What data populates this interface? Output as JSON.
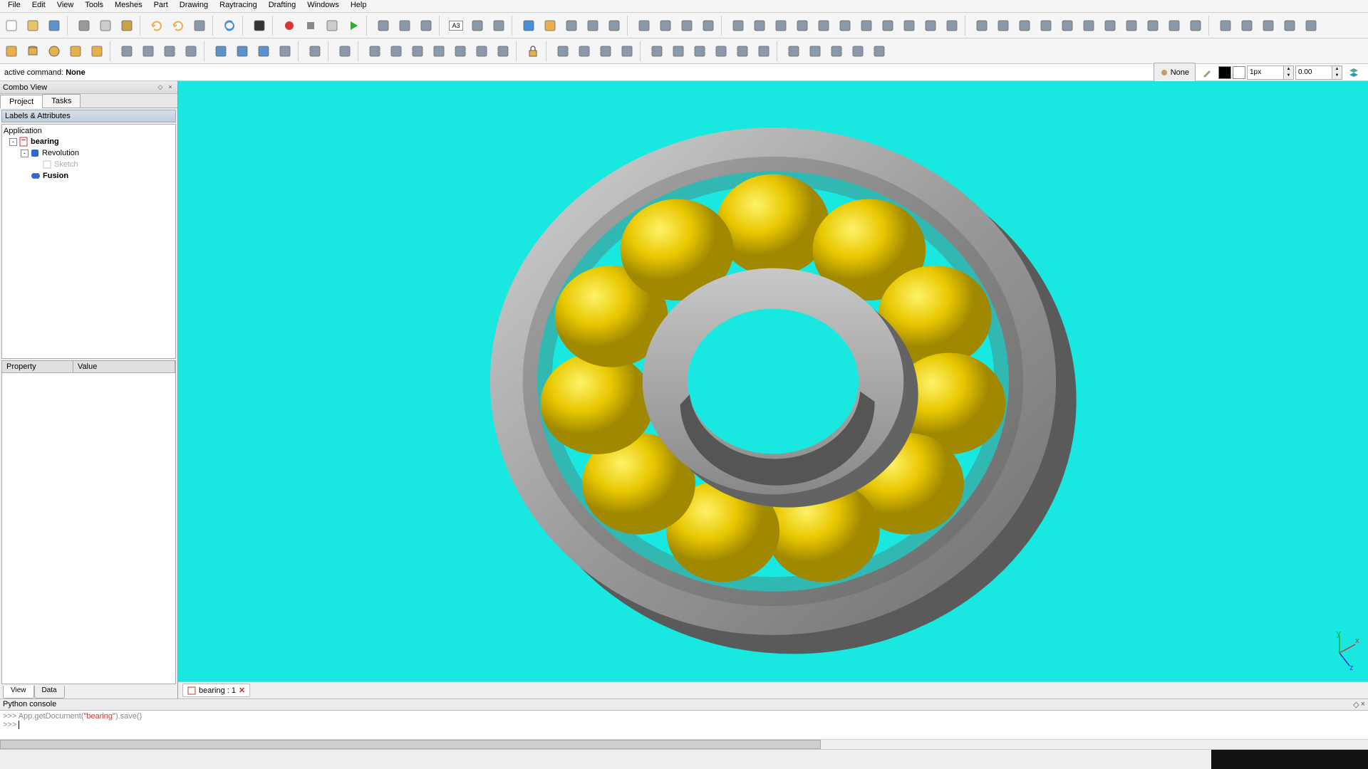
{
  "menu": [
    "File",
    "Edit",
    "View",
    "Tools",
    "Meshes",
    "Part",
    "Drawing",
    "Raytracing",
    "Drafting",
    "Windows",
    "Help"
  ],
  "commandbar": {
    "label": "active command:",
    "value": "None",
    "none_btn": "None",
    "px_field": "1px",
    "num_field": "0.00"
  },
  "combo": {
    "title": "Combo View",
    "tabs": [
      "Project",
      "Tasks"
    ],
    "active_tab": 0,
    "section": "Labels & Attributes",
    "tree": {
      "root": "Application",
      "items": [
        {
          "level": 0,
          "exp": "-",
          "icon": "doc",
          "label": "bearing",
          "bold": true
        },
        {
          "level": 1,
          "exp": "-",
          "icon": "rev",
          "label": "Revolution",
          "bold": false
        },
        {
          "level": 2,
          "exp": "",
          "icon": "sketch",
          "label": "Sketch",
          "bold": false,
          "dim": true
        },
        {
          "level": 1,
          "exp": "",
          "icon": "fusion",
          "label": "Fusion",
          "bold": true
        }
      ]
    },
    "prop_headers": [
      "Property",
      "Value"
    ],
    "bottom_tabs": [
      "View",
      "Data"
    ],
    "bottom_active": 0
  },
  "doc_tab": {
    "label": "bearing : 1"
  },
  "python": {
    "title": "Python console",
    "line1_prefix": ">>> App.getDocument(",
    "line1_arg": "\"bearing\"",
    "line1_suffix": ").save()",
    "prompt": ">>> "
  },
  "icons_row1": [
    "new",
    "open",
    "save",
    "|",
    "cut",
    "copy",
    "paste",
    "|",
    "undo",
    "redo",
    "drop",
    "|",
    "refresh",
    "|",
    "whatsthis",
    "|",
    "record",
    "stop",
    "edit",
    "play",
    "|",
    "sel1",
    "sel2",
    "sel3",
    "|",
    "a3",
    "page",
    "print",
    "|",
    "zoom-fit",
    "iso",
    "axo",
    "front",
    "back",
    "|",
    "top",
    "bottom",
    "left",
    "right",
    "|",
    "line",
    "arc",
    "pline",
    "angle",
    "rect",
    "shape",
    "trim",
    "ext",
    "mirror",
    "text",
    "dim",
    "|",
    "move",
    "rot",
    "mir2",
    "cut2",
    "offset",
    "align",
    "arr-l",
    "arr-r",
    "arr-u",
    "arr-d",
    "grid",
    "|",
    "wire",
    "solid",
    "sketch",
    "hide",
    "show"
  ],
  "icons_row2": [
    "box",
    "cyl",
    "sphere",
    "cone",
    "torus",
    "|",
    "shell",
    "loft",
    "sweep",
    "rev",
    "|",
    "union",
    "diff",
    "inter",
    "cut3",
    "|",
    "sketch2",
    "|",
    "export",
    "|",
    "snap1",
    "snap2",
    "snap3",
    "snap4",
    "snap5",
    "snap6",
    "snap7",
    "|",
    "lock",
    "|",
    "m1",
    "m2",
    "m3",
    "m4",
    "|",
    "n1",
    "n2",
    "n3",
    "n4",
    "n5",
    "n6",
    "|",
    "p1",
    "p2",
    "p3",
    "p4",
    "p5"
  ]
}
